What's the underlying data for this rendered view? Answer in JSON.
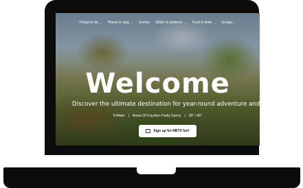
{
  "nav": {
    "items": [
      {
        "label": "Things to do",
        "chevron": "⌄"
      },
      {
        "label": "Places to stay",
        "chevron": "⌄"
      },
      {
        "label": "Events",
        "chevron": ""
      },
      {
        "label": "Water & outdoors",
        "chevron": "⌄"
      },
      {
        "label": "Food & drink",
        "chevron": "⌄"
      },
      {
        "label": "Groups",
        "chevron": "⌄"
      }
    ]
  },
  "hero": {
    "title": "Welcome",
    "tagline": "Discover the ultimate destination for year-round adventure and fun",
    "time": "8:44am",
    "sep1": "|",
    "weather": "Areas Of Fog then Partly Sunny",
    "sep2": "|",
    "temps": "90° / 66°",
    "cta_label": "Sign up for NBTX fun!"
  }
}
